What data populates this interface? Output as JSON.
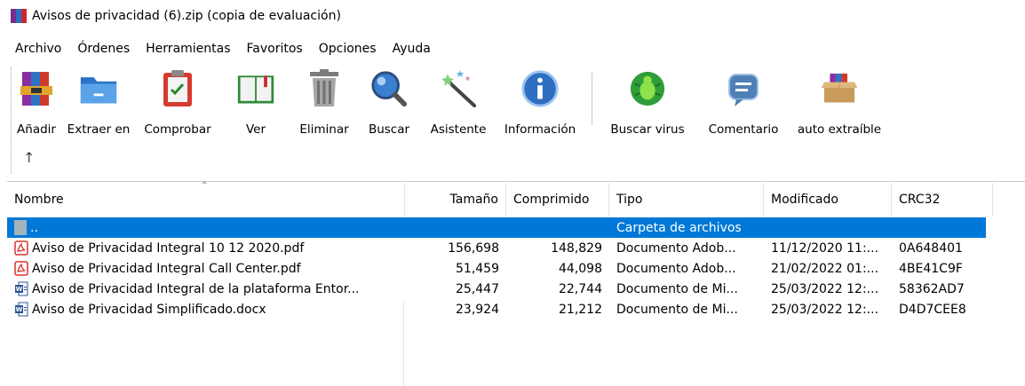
{
  "window": {
    "title": "Avisos de privacidad (6).zip (copia de evaluación)"
  },
  "menu": [
    "Archivo",
    "Órdenes",
    "Herramientas",
    "Favoritos",
    "Opciones",
    "Ayuda"
  ],
  "toolbar": [
    {
      "label": "Añadir",
      "icon": "add-archive-icon"
    },
    {
      "label": "Extraer en",
      "icon": "extract-folder-icon"
    },
    {
      "label": "Comprobar",
      "icon": "test-clipboard-icon"
    },
    {
      "label": "Ver",
      "icon": "view-book-icon"
    },
    {
      "label": "Eliminar",
      "icon": "trash-icon"
    },
    {
      "label": "Buscar",
      "icon": "magnifier-icon"
    },
    {
      "label": "Asistente",
      "icon": "wizard-wand-icon"
    },
    {
      "label": "Información",
      "icon": "info-icon"
    },
    {
      "label": "Buscar virus",
      "icon": "virus-bug-icon"
    },
    {
      "label": "Comentario",
      "icon": "comment-icon"
    },
    {
      "label": "auto extraíble",
      "icon": "sfx-box-icon"
    }
  ],
  "navigation": {
    "up_icon": "up-arrow-icon"
  },
  "columns": [
    "Nombre",
    "Tamaño",
    "Comprimido",
    "Tipo",
    "Modificado",
    "CRC32"
  ],
  "parent_row": {
    "name": "..",
    "type": "Carpeta de archivos"
  },
  "files": [
    {
      "name": "Aviso de Privacidad Integral 10 12 2020.pdf",
      "size": "156,698",
      "packed": "148,829",
      "type": "Documento Adob...",
      "modified": "11/12/2020 11:...",
      "crc": "0A648401",
      "icon": "pdf-icon"
    },
    {
      "name": "Aviso de Privacidad Integral Call Center.pdf",
      "size": "51,459",
      "packed": "44,098",
      "type": "Documento Adob...",
      "modified": "21/02/2022 01:...",
      "crc": "4BE41C9F",
      "icon": "pdf-icon"
    },
    {
      "name": "Aviso de Privacidad Integral de la plataforma Entor...",
      "size": "25,447",
      "packed": "22,744",
      "type": "Documento de Mi...",
      "modified": "25/03/2022 12:...",
      "crc": "58362AD7",
      "icon": "word-icon"
    },
    {
      "name": "Aviso de Privacidad Simplificado.docx",
      "size": "23,924",
      "packed": "21,212",
      "type": "Documento de Mi...",
      "modified": "25/03/2022 12:...",
      "crc": "D4D7CEE8",
      "icon": "word-icon"
    }
  ],
  "colors": {
    "selection": "#0078d7",
    "pdf": "#d9342b",
    "word": "#2b579a"
  }
}
